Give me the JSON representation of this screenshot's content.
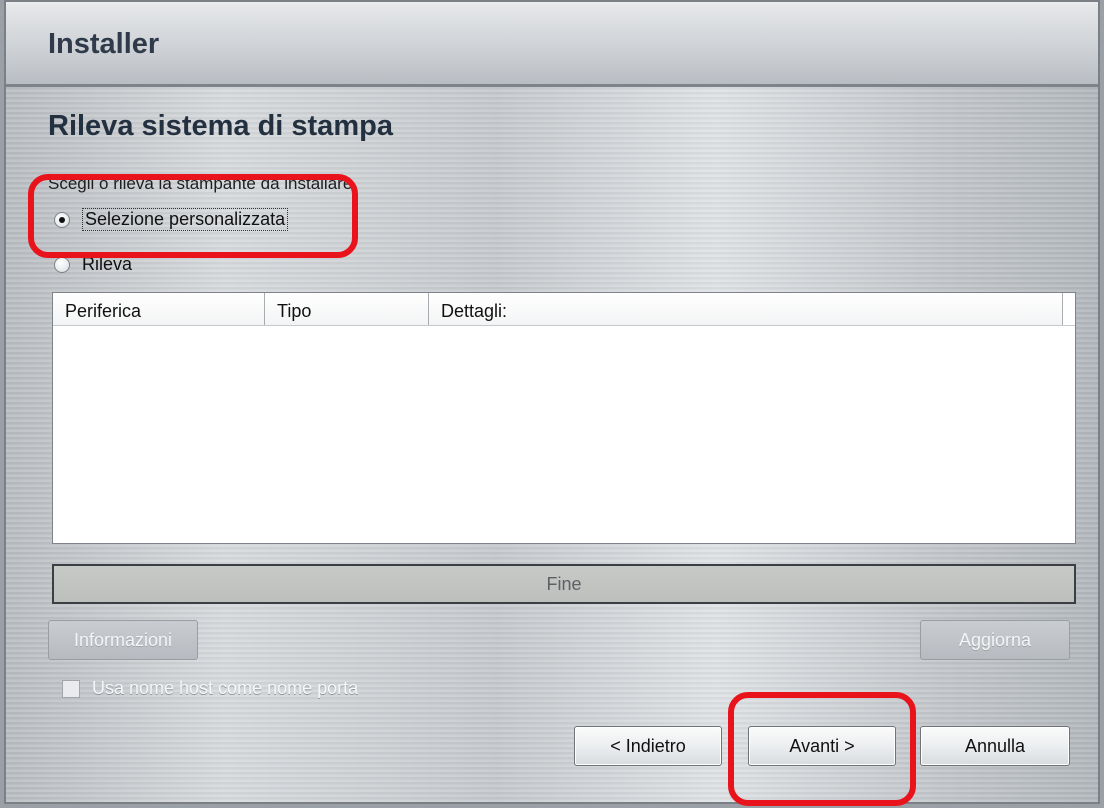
{
  "window": {
    "title": "Installer"
  },
  "page": {
    "heading": "Rileva sistema di stampa",
    "instruction": "Scegli o rileva la stampante da installare."
  },
  "options": {
    "custom_selection": {
      "label": "Selezione personalizzata",
      "selected": true
    },
    "detect": {
      "label": "Rileva",
      "selected": false
    }
  },
  "device_list": {
    "columns": [
      "Periferica",
      "Tipo",
      "Dettagli:"
    ],
    "rows": []
  },
  "status": {
    "text": "Fine"
  },
  "actions": {
    "info_label": "Informazioni",
    "refresh_label": "Aggiorna",
    "use_hostname_label": "Usa nome host come nome porta",
    "back_label": "< Indietro",
    "next_label": "Avanti >",
    "cancel_label": "Annulla"
  },
  "highlight_color": "#e8131b"
}
